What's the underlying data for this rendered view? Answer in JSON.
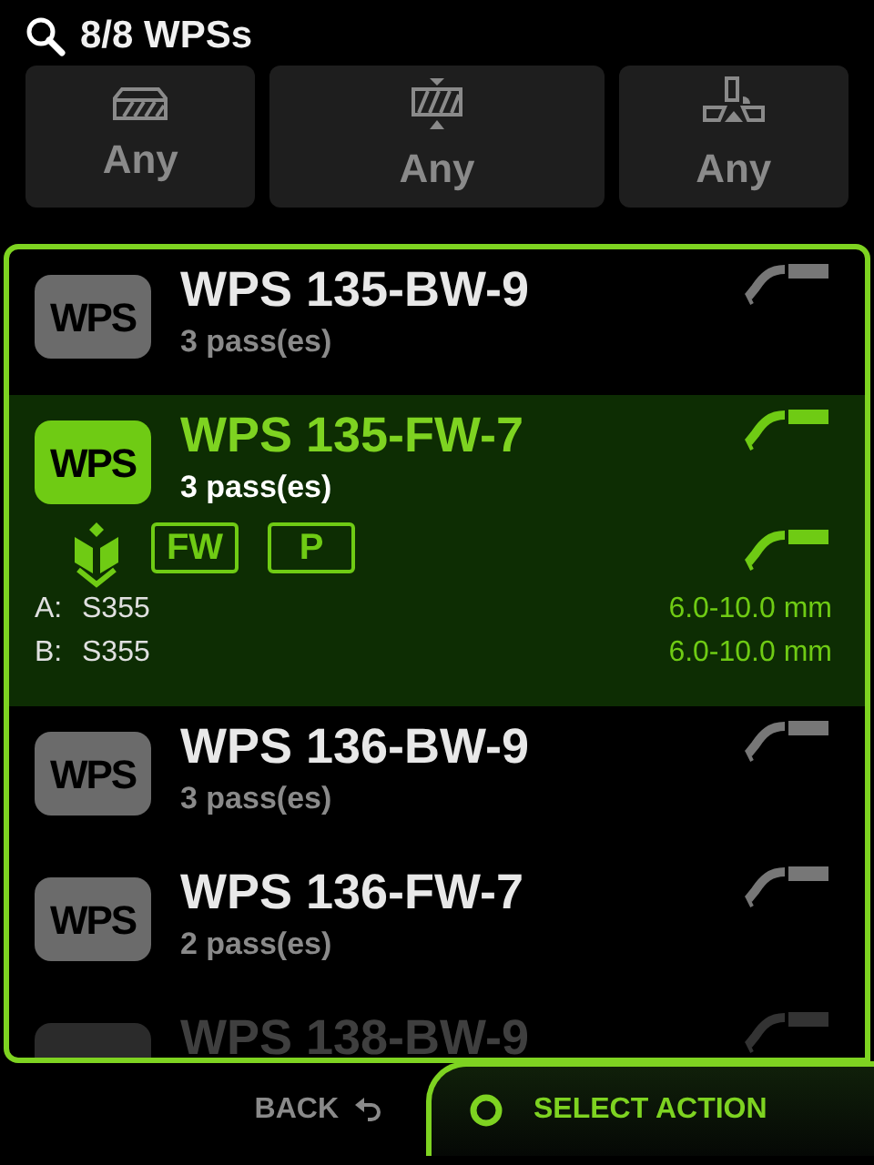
{
  "search": {
    "count": "8/8 WPSs"
  },
  "filters": [
    {
      "kind": "material",
      "label": "Any"
    },
    {
      "kind": "thickness",
      "label": "Any"
    },
    {
      "kind": "position",
      "label": "Any"
    }
  ],
  "wps": [
    {
      "logo": "WPS",
      "name": "WPS 135-BW-9",
      "passes": "3 pass(es)",
      "selected": false,
      "faded": false
    },
    {
      "logo": "WPS",
      "name": "WPS 135-FW-7",
      "passes": "3 pass(es)",
      "selected": true,
      "faded": false,
      "tags": [
        "FW",
        "P"
      ],
      "materials": [
        {
          "label": "A:",
          "value": "S355",
          "range": "6.0-10.0 mm"
        },
        {
          "label": "B:",
          "value": "S355",
          "range": "6.0-10.0 mm"
        }
      ]
    },
    {
      "logo": "WPS",
      "name": "WPS 136-BW-9",
      "passes": "3 pass(es)",
      "selected": false,
      "faded": false
    },
    {
      "logo": "WPS",
      "name": "WPS 136-FW-7",
      "passes": "2 pass(es)",
      "selected": false,
      "faded": false
    },
    {
      "name": "WPS 138-BW-9",
      "selected": false,
      "faded": true
    }
  ],
  "footer": {
    "back": "BACK",
    "action": "SELECT ACTION"
  }
}
